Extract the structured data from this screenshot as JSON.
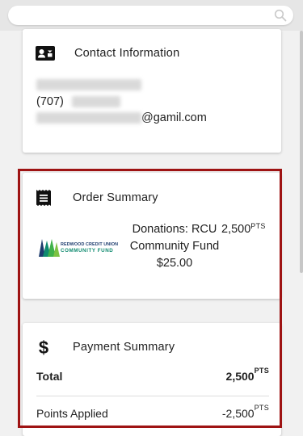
{
  "search": {
    "placeholder": ""
  },
  "contact": {
    "title": "Contact Information",
    "phone_prefix": "(707)",
    "email_suffix": "@gamil.com"
  },
  "order": {
    "title": "Order Summary",
    "item_name": "Donations: RCU Community Fund",
    "item_name_line1": "Donations: RCU",
    "item_name_line2": "Community Fund",
    "item_price": "$25.00",
    "item_points": "2,500",
    "points_unit": "PTS",
    "logo": {
      "line1": "REDWOOD CREDIT UNION",
      "line2": "COMMUNITY FUND",
      "colors": [
        "#0e8a6f",
        "#3fb24a",
        "#1d3c6e",
        "#7cc242"
      ]
    }
  },
  "payment": {
    "title": "Payment Summary",
    "total_label": "Total",
    "total_value": "2,500",
    "points_applied_label": "Points Applied",
    "points_applied_value": "-2,500",
    "points_unit": "PTS"
  },
  "colors": {
    "highlight_border": "#9e1313"
  }
}
